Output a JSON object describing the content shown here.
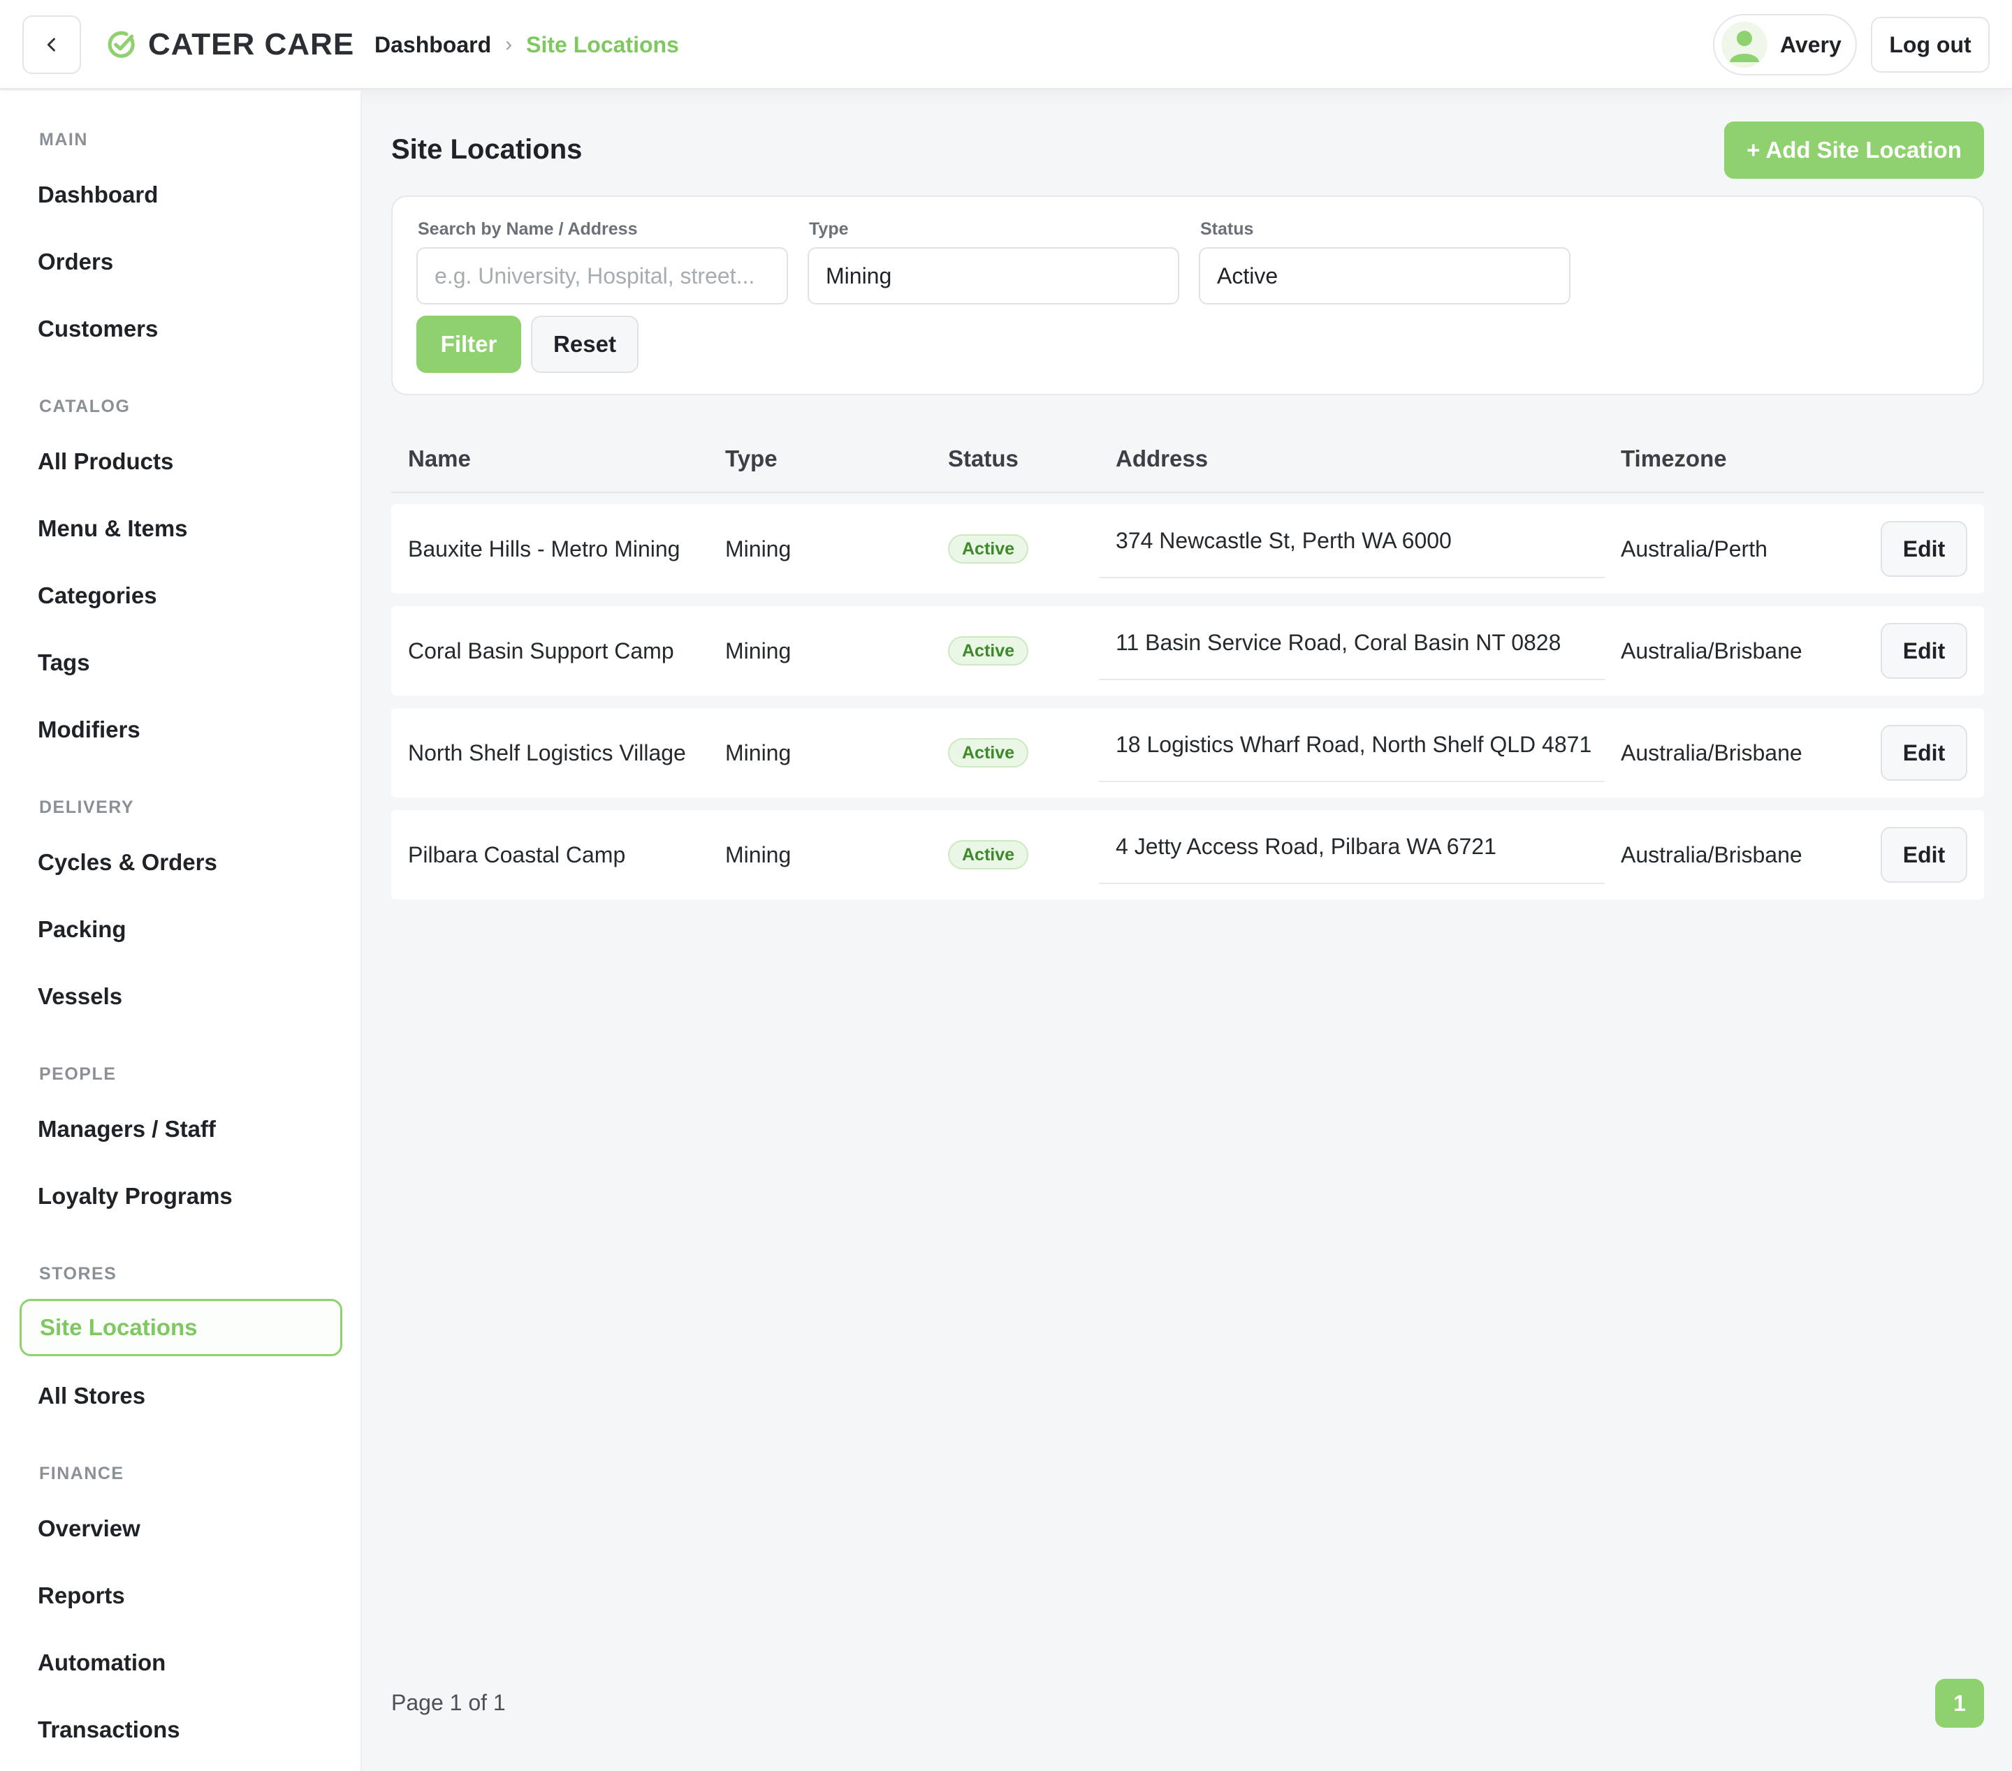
{
  "brand": {
    "name": "CATER CARE",
    "accent": "#8fd16f"
  },
  "breadcrumb": {
    "home": "Dashboard",
    "separator": "›",
    "current": "Site Locations"
  },
  "user": {
    "name": "Avery",
    "logout_label": "Log out"
  },
  "sidebar": {
    "sections": [
      {
        "title": "MAIN",
        "items": [
          "Dashboard",
          "Orders",
          "Customers"
        ]
      },
      {
        "title": "CATALOG",
        "items": [
          "All Products",
          "Menu & Items",
          "Categories",
          "Tags",
          "Modifiers"
        ]
      },
      {
        "title": "DELIVERY",
        "items": [
          "Cycles & Orders",
          "Packing",
          "Vessels"
        ]
      },
      {
        "title": "PEOPLE",
        "items": [
          "Managers / Staff",
          "Loyalty Programs"
        ]
      },
      {
        "title": "STORES",
        "items": [
          "Site Locations",
          "All Stores"
        ]
      },
      {
        "title": "FINANCE",
        "items": [
          "Overview",
          "Reports",
          "Automation",
          "Transactions"
        ]
      }
    ],
    "active_item": "Site Locations"
  },
  "page": {
    "title": "Site Locations",
    "add_button": "+ Add Site Location"
  },
  "filters": {
    "search_label": "Search by Name / Address",
    "search_placeholder": "e.g. University, Hospital, street...",
    "search_value": "",
    "type_label": "Type",
    "type_value": "Mining",
    "status_label": "Status",
    "status_value": "Active",
    "filter_button": "Filter",
    "reset_button": "Reset"
  },
  "table": {
    "columns": [
      "Name",
      "Type",
      "Status",
      "Address",
      "Timezone"
    ],
    "rows": [
      {
        "name": "Bauxite Hills - Metro Mining",
        "type": "Mining",
        "status": "Active",
        "address": "374 Newcastle St, Perth WA 6000",
        "timezone": "Australia/Perth",
        "action": "Edit"
      },
      {
        "name": "Coral Basin Support Camp",
        "type": "Mining",
        "status": "Active",
        "address": "11 Basin Service Road, Coral Basin NT 0828",
        "timezone": "Australia/Brisbane",
        "action": "Edit"
      },
      {
        "name": "North Shelf Logistics Village",
        "type": "Mining",
        "status": "Active",
        "address": "18 Logistics Wharf Road, North Shelf QLD 4871",
        "timezone": "Australia/Brisbane",
        "action": "Edit"
      },
      {
        "name": "Pilbara Coastal Camp",
        "type": "Mining",
        "status": "Active",
        "address": "4 Jetty Access Road, Pilbara WA 6721",
        "timezone": "Australia/Brisbane",
        "action": "Edit"
      }
    ]
  },
  "pagination": {
    "info": "Page 1 of 1",
    "current_page": "1"
  }
}
